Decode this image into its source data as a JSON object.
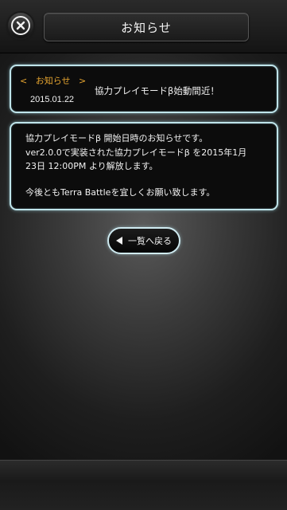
{
  "header": {
    "title": "お知らせ",
    "close_icon": "close-circle-icon"
  },
  "notice": {
    "category_open": "<",
    "category": "お知らせ",
    "category_close": ">",
    "date": "2015.01.22",
    "headline": "協力プレイモードβ始動間近！",
    "category_color": "#e8a630"
  },
  "body": {
    "lines": [
      "協力プレイモードβ 開始日時のお知らせです。",
      "ver2.0.0で実装された協力プレイモードβ を2015年1月",
      "23日 12:00PM より解放します。",
      "今後ともTerra Battleを宜しくお願い致します。"
    ]
  },
  "back_button": {
    "label": "一覧へ戻る",
    "icon": "triangle-left-icon"
  },
  "colors": {
    "card_border": "#bfe4ea",
    "card_background": "#0c0c0c",
    "text": "#f2f2f2"
  }
}
